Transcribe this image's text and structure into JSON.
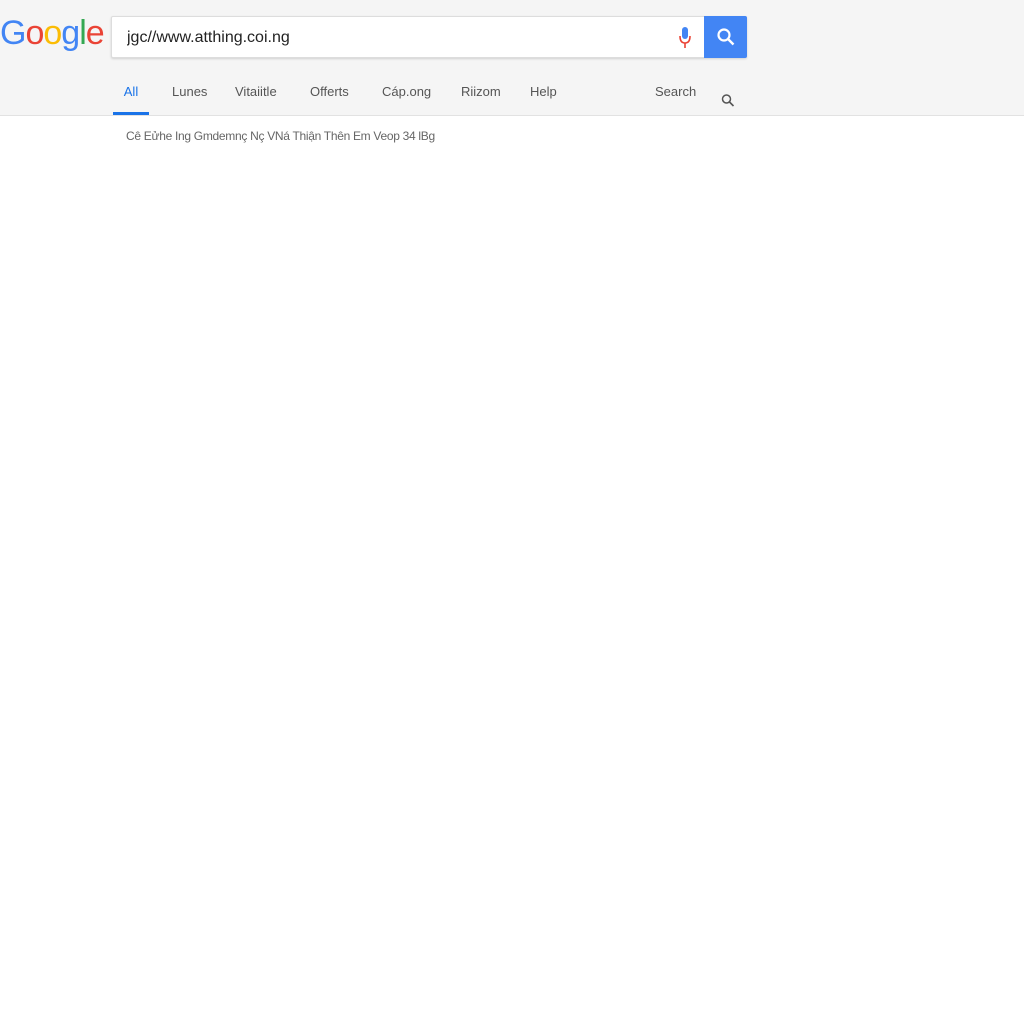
{
  "logo": {
    "text": "Google",
    "letters": [
      {
        "c": "G",
        "color": "#4285f4"
      },
      {
        "c": "o",
        "color": "#ea4335"
      },
      {
        "c": "o",
        "color": "#fbbc05"
      },
      {
        "c": "g",
        "color": "#4285f4"
      },
      {
        "c": "l",
        "color": "#34a853"
      },
      {
        "c": "e",
        "color": "#ea4335"
      }
    ]
  },
  "search": {
    "value": "jgc//www.atthing.coi.ng"
  },
  "tabs": [
    {
      "label": "All",
      "active": true
    },
    {
      "label": "Lunes"
    },
    {
      "label": "Vitaiitle"
    },
    {
      "label": "Offerts"
    },
    {
      "label": "Cáp.ong"
    },
    {
      "label": "Riizom"
    },
    {
      "label": "Help"
    }
  ],
  "tools": {
    "search_label": "Search"
  },
  "results": {
    "stats": "Cê Eửhe Ing Gmdemnç Nç VNá Thiận Thên Em Veop 34 lBg"
  },
  "colors": {
    "accent": "#1a73e8",
    "search_button": "#4285f4"
  }
}
